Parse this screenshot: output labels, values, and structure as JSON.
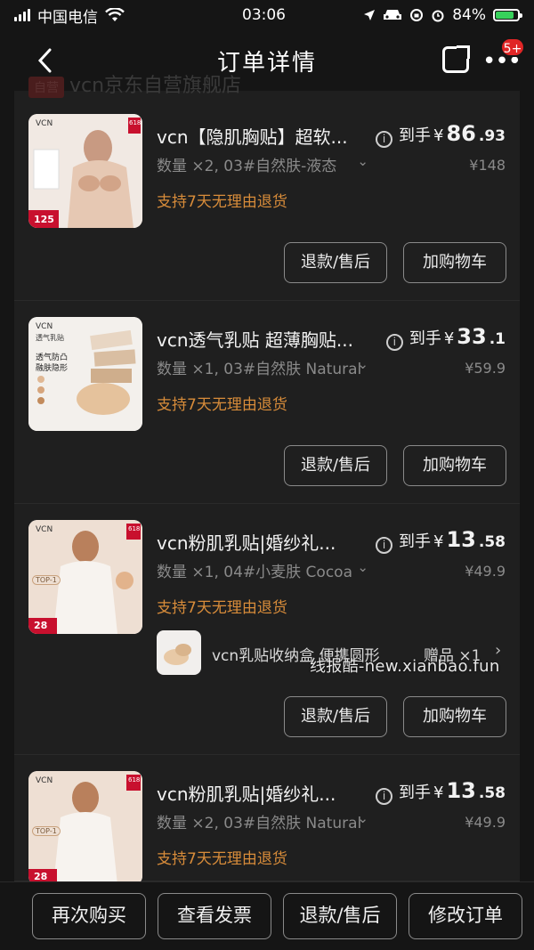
{
  "status": {
    "carrier": "中国电信",
    "time": "03:06",
    "battery": "84%"
  },
  "header": {
    "title": "订单详情",
    "ghost_store": "vcn京东自营旗舰店",
    "ghost_tag": "自营",
    "badge": "5+"
  },
  "items": [
    {
      "name": "vcn【隐肌胸贴】超软...",
      "spec": "数量 ×2, 03#自然肤-液态",
      "return_policy": "支持7天无理由退货",
      "price_label": "到手",
      "price_symbol": "¥",
      "price_int": "86",
      "price_dec": ".93",
      "original_price": "¥148",
      "btn_refund": "退款/售后",
      "btn_cart": "加购物车",
      "thumb_text": [
        "VCN",
        "618",
        "125",
        "抢到手"
      ]
    },
    {
      "name": "vcn透气乳贴 超薄胸贴...",
      "spec": "数量 ×1, 03#自然肤 Natural",
      "return_policy": "支持7天无理由退货",
      "price_label": "到手",
      "price_symbol": "¥",
      "price_int": "33",
      "price_dec": ".1",
      "original_price": "¥59.9",
      "btn_refund": "退款/售后",
      "btn_cart": "加购物车",
      "thumb_text": [
        "VCN",
        "透气乳贴",
        "透气防凸",
        "融肤隐形"
      ]
    },
    {
      "name": "vcn粉肌乳贴|婚纱礼...",
      "spec": "数量 ×1, 04#小麦肤 Cocoa",
      "return_policy": "支持7天无理由退货",
      "price_label": "到手",
      "price_symbol": "¥",
      "price_int": "13",
      "price_dec": ".58",
      "original_price": "¥49.9",
      "btn_refund": "退款/售后",
      "btn_cart": "加购物车",
      "gift_name": "vcn乳贴收纳盒 便携圆形",
      "gift_label": "赠品 ×1",
      "thumb_text": [
        "VCN",
        "618",
        "TOP-1",
        "28"
      ]
    },
    {
      "name": "vcn粉肌乳贴|婚纱礼...",
      "spec": "数量 ×2, 03#自然肤 Natural",
      "return_policy": "支持7天无理由退货",
      "price_label": "到手",
      "price_symbol": "¥",
      "price_int": "13",
      "price_dec": ".58",
      "original_price": "¥49.9",
      "thumb_text": [
        "VCN",
        "618",
        "TOP-1",
        "28"
      ]
    }
  ],
  "watermark": "线报酷-new.xianbao.fun",
  "bottom": {
    "buy_again": "再次购买",
    "view_invoice": "查看发票",
    "refund": "退款/售后",
    "modify": "修改订单"
  },
  "colors": {
    "accent_orange": "#d88c3a",
    "badge_red": "#e02525",
    "battery_green": "#37d15b"
  }
}
